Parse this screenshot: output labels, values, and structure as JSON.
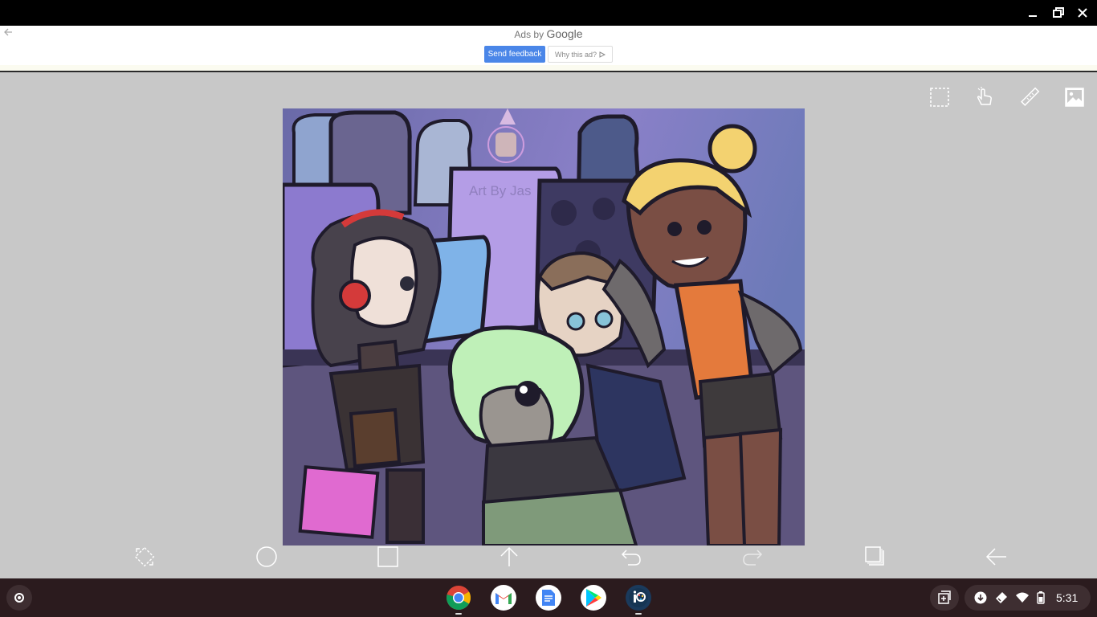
{
  "window": {
    "controls": [
      "minimize-icon",
      "maximize-icon",
      "close-icon"
    ]
  },
  "ad": {
    "ads_by": "Ads by",
    "google": "Google",
    "send_feedback": "Send feedback",
    "why_this_ad": "Why this ad?"
  },
  "canvas": {
    "watermark": "Art By Jas",
    "top_tools": [
      "selection-icon",
      "hand-gesture-icon",
      "ruler-icon",
      "image-icon"
    ],
    "bottom_tools": [
      "transform-icon",
      "ellipse-icon",
      "rectangle-icon",
      "upload-icon",
      "undo-icon",
      "redo-icon",
      "layers-icon",
      "back-icon"
    ]
  },
  "shelf": {
    "apps": [
      "chrome",
      "gmail",
      "docs",
      "play-store",
      "ibis-paint"
    ],
    "time": "5:31"
  },
  "colors": {
    "titlebar": "#000000",
    "workspace": "#c8c8c8",
    "shelf": "#2b1b1e",
    "feedback_button": "#4a86e8"
  }
}
